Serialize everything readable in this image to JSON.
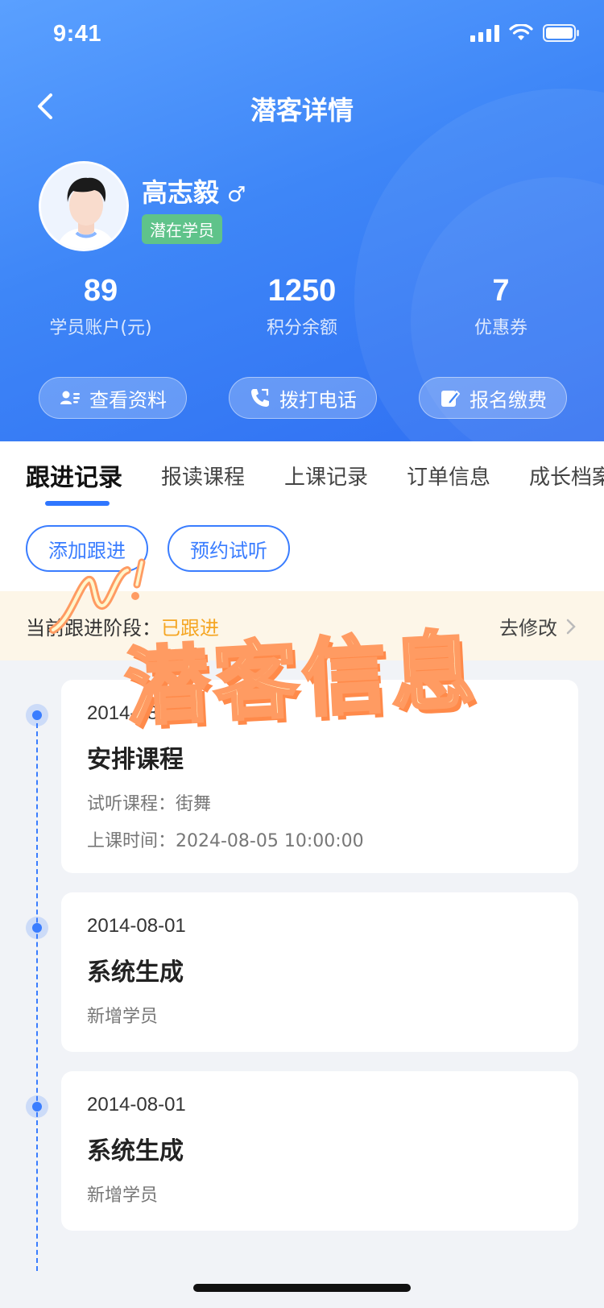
{
  "status_bar": {
    "time": "9:41"
  },
  "nav": {
    "title": "潜客详情"
  },
  "profile": {
    "name": "高志毅",
    "gender_symbol": "♂",
    "tag": "潜在学员"
  },
  "stats": [
    {
      "value": "89",
      "label": "学员账户(元)"
    },
    {
      "value": "1250",
      "label": "积分余额"
    },
    {
      "value": "7",
      "label": "优惠券"
    }
  ],
  "actions": [
    {
      "label": "查看资料",
      "icon": "contact-card-icon"
    },
    {
      "label": "拨打电话",
      "icon": "phone-call-icon"
    },
    {
      "label": "报名缴费",
      "icon": "edit-pay-icon"
    }
  ],
  "tabs": [
    "跟进记录",
    "报读课程",
    "上课记录",
    "订单信息",
    "成长档案"
  ],
  "buttons": {
    "add_followup": "添加跟进",
    "book_trial": "预约试听"
  },
  "stage": {
    "label": "当前跟进阶段：",
    "value": "已跟进",
    "edit": "去修改"
  },
  "timeline": [
    {
      "date": "2014-08-01",
      "title": "安排课程",
      "lines": [
        "试听课程：街舞",
        "上课时间：2024-08-05 10:00:00"
      ]
    },
    {
      "date": "2014-08-01",
      "title": "系统生成",
      "lines": [
        "新增学员"
      ]
    },
    {
      "date": "2014-08-01",
      "title": "系统生成",
      "lines": [
        "新增学员"
      ]
    }
  ],
  "overlay": {
    "text": "潜客信息"
  },
  "colors": {
    "primary": "#3a7dff",
    "header_start": "#5aa0ff",
    "header_end": "#2f6ff2",
    "tag": "#5fc38a",
    "stage_bg": "#fdf6e8",
    "stage_value": "#f5a623",
    "overlay_fill": "#fff6cc",
    "overlay_stroke": "#ff9b62"
  }
}
